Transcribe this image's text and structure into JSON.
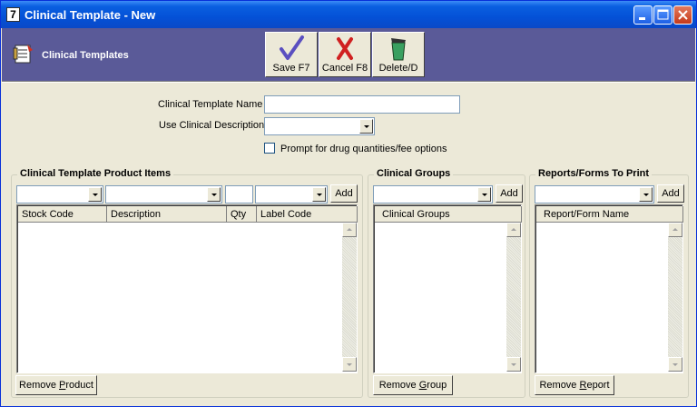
{
  "window": {
    "title": "Clinical Template - New",
    "app_icon_text": "7",
    "controls": [
      "minimize",
      "maximize",
      "close"
    ]
  },
  "header": {
    "title": "Clinical Templates",
    "icon": "notepad-icon",
    "buttons": {
      "save": "Save F7",
      "cancel": "Cancel F8",
      "delete": "Delete/D"
    }
  },
  "form": {
    "template_name_label": "Clinical Template Name",
    "template_name_value": "",
    "use_description_label": "Use Clinical Description",
    "use_description_value": "",
    "prompt_checkbox_label": "Prompt for drug quantities/fee options",
    "prompt_checked": false
  },
  "products": {
    "title": "Clinical Template Product Items",
    "add_label": "Add",
    "columns": [
      "Stock Code",
      "Description",
      "Qty",
      "Label Code"
    ],
    "rows": [],
    "remove_prefix": "Remove ",
    "remove_accel": "P",
    "remove_suffix": "roduct"
  },
  "groups": {
    "title": "Clinical Groups",
    "add_label": "Add",
    "columns": [
      "Clinical Groups"
    ],
    "rows": [],
    "remove_prefix": "Remove ",
    "remove_accel": "G",
    "remove_suffix": "roup"
  },
  "reports": {
    "title": "Reports/Forms To Print",
    "add_label": "Add",
    "columns": [
      "Report/Form Name"
    ],
    "rows": [],
    "remove_prefix": "Remove ",
    "remove_accel": "R",
    "remove_suffix": "eport"
  },
  "colors": {
    "titlebar": "#0a5fe0",
    "header_band": "#5a5a98",
    "window_bg": "#ece9d8"
  }
}
